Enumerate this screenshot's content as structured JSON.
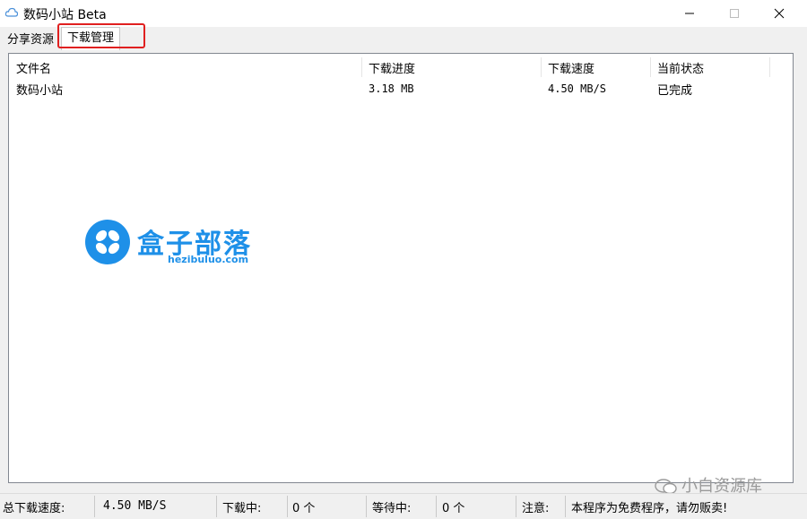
{
  "window": {
    "title": "数码小站 Beta"
  },
  "tabs": [
    {
      "label": "分享资源",
      "active": false
    },
    {
      "label": "下载管理",
      "active": true
    }
  ],
  "table": {
    "columns": [
      "文件名",
      "下载进度",
      "下载速度",
      "当前状态"
    ],
    "rows": [
      {
        "name": "数码小站",
        "progress": "3.18 MB",
        "speed": "4.50 MB/S",
        "status": "已完成"
      }
    ]
  },
  "watermark": {
    "logo_text": "盒子部落",
    "logo_url": "hezibuluo.com",
    "bottom_text": "小白资源库"
  },
  "statusbar": {
    "total_speed_label": "总下载速度:",
    "total_speed_value": "4.50 MB/S",
    "downloading_label": "下载中:",
    "downloading_value": "0 个",
    "waiting_label": "等待中:",
    "waiting_value": "0 个",
    "note_label": "注意:",
    "note_value": "本程序为免费程序，请勿贩卖!"
  },
  "colors": {
    "accent": "#1e90e8",
    "highlight": "#e02020"
  }
}
